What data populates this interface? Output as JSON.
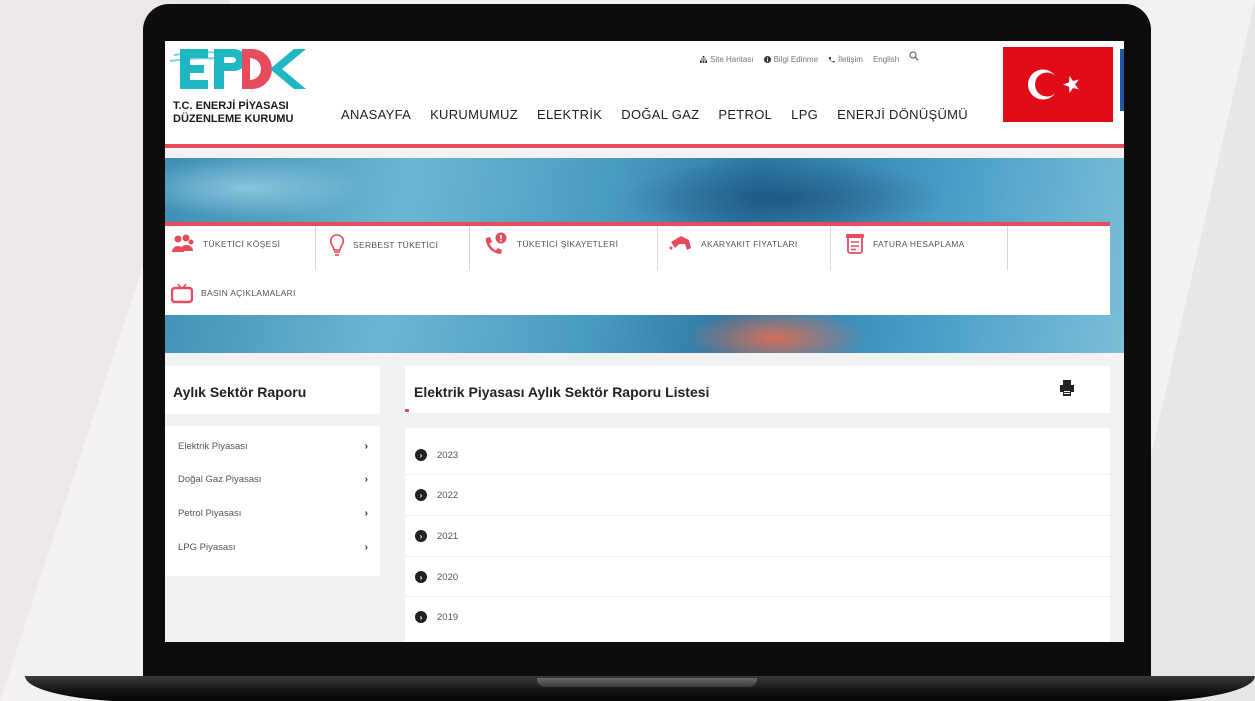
{
  "logo": {
    "mark": "EPDK",
    "line1": "T.C. ENERJİ PİYASASI",
    "line2": "DÜZENLEME KURUMU"
  },
  "utility": {
    "site_map": "Site Haritası",
    "info": "Bilgi Edinme",
    "contact": "İletişim",
    "english": "English"
  },
  "nav": [
    "ANASAYFA",
    "KURUMUMUZ",
    "ELEKTRİK",
    "DOĞAL GAZ",
    "PETROL",
    "LPG",
    "ENERJİ DÖNÜŞÜMÜ"
  ],
  "quick_links": [
    "TÜKETİCİ KÖŞESİ",
    "SERBEST TÜKETİCİ",
    "TÜKETİCİ ŞİKAYETLERİ",
    "AKARYAKIT FİYATLARI",
    "FATURA HESAPLAMA",
    "BASIN AÇIKLAMALARI"
  ],
  "sidebar": {
    "title": "Aylık Sektör Raporu",
    "items": [
      "Elektrik Piyasası",
      "Doğal Gaz Piyasası",
      "Petrol Piyasası",
      "LPG Piyasası"
    ]
  },
  "main": {
    "title": "Elektrik Piyasası Aylık Sektör Raporu Listesi",
    "years": [
      "2023",
      "2022",
      "2021",
      "2020",
      "2019"
    ]
  },
  "colors": {
    "accent_red": "#e64c5c",
    "flag_red": "#e30a17",
    "logo_teal": "#20b7c4"
  },
  "icons": {
    "search": "search-icon",
    "sitemap": "sitemap-icon",
    "info": "info-icon",
    "phone": "phone-icon",
    "scroll_down": "chevron-down-icon",
    "print": "printer-icon"
  }
}
